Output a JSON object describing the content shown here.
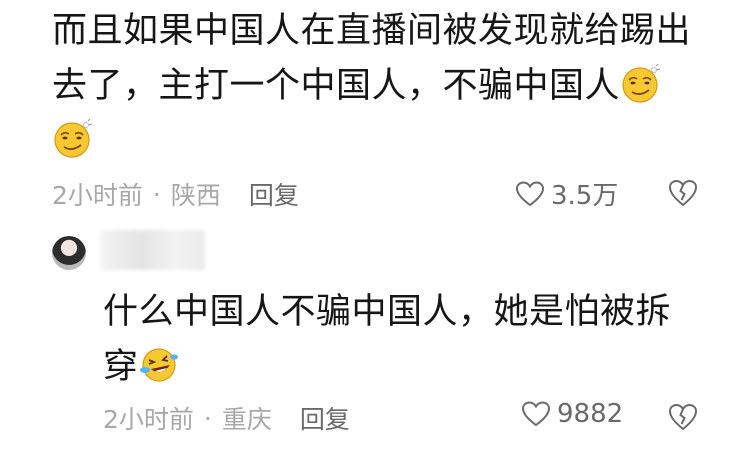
{
  "comments": [
    {
      "text_line1": "而且如果中国人在直播间被发现就给踢出",
      "text_line2": "去了，主打一个中国人，不骗中国人",
      "emoji1": "smirk-emoji",
      "emoji2": "smirk-emoji",
      "time": "2小时前",
      "separator": "·",
      "location": "陕西",
      "reply_label": "回复",
      "likes": "3.5万"
    },
    {
      "username": "",
      "text_line1": "什么中国人不骗中国人，她是怕被拆",
      "text_line2": "穿",
      "emoji1": "laughing-tears-emoji",
      "time": "2小时前",
      "separator": "·",
      "location": "重庆",
      "reply_label": "回复",
      "likes": "9882"
    }
  ],
  "icons": {
    "like": "heart-outline-icon",
    "dislike": "broken-heart-icon"
  },
  "colors": {
    "text": "#161616",
    "meta": "#a8a8a8",
    "emoji_yellow": "#f7c832"
  }
}
